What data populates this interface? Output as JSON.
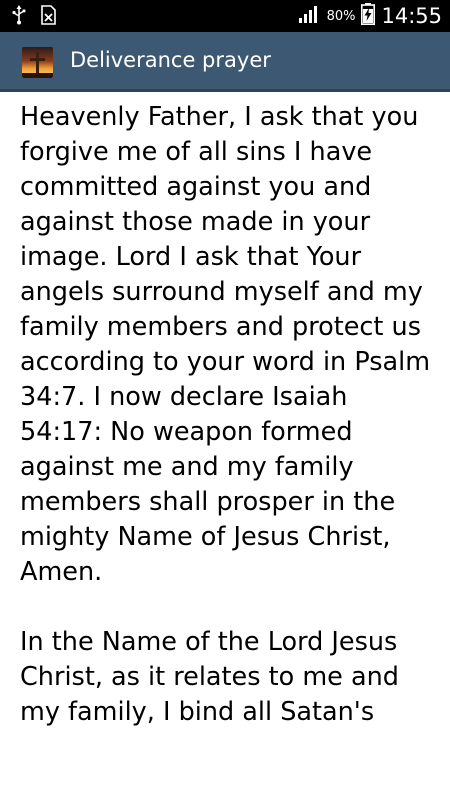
{
  "status_bar": {
    "battery_percent": "80%",
    "time": "14:55",
    "icons": [
      "usb-icon",
      "sim-blocked-icon",
      "signal-icon",
      "battery-charging-icon"
    ]
  },
  "action_bar": {
    "title": "Deliverance prayer",
    "app_icon": "cross-sunset-icon"
  },
  "content": {
    "text": "Heavenly Father, I ask that you forgive me of all sins I have committed against you and against those made in your image. Lord I ask that Your angels surround myself and my family members and protect us according to your word in Psalm 34:7. I now declare Isaiah 54:17: No weapon formed against me and my family members shall prosper in the mighty Name of Jesus Christ, Amen.\n\nIn the Name of the Lord Jesus Christ, as it relates to me and my family, I bind all Satan's"
  }
}
